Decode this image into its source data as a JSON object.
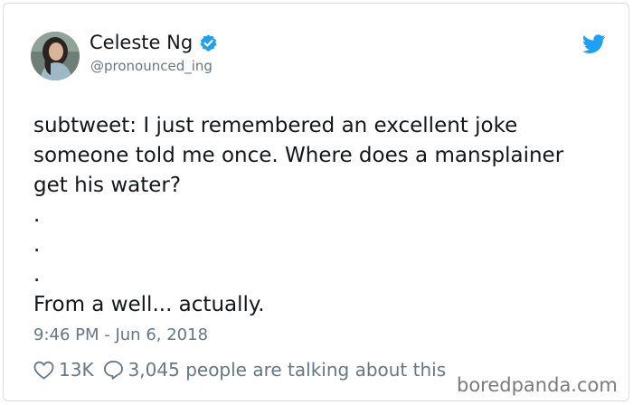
{
  "author": {
    "name": "Celeste Ng",
    "handle": "@pronounced_ing",
    "verified": true,
    "avatar_icon": "profile-photo"
  },
  "tweet": {
    "lines": [
      "subtweet: I just remembered an excellent joke",
      "someone told me once. Where does a mansplainer",
      "get his water?",
      ".",
      ".",
      ".",
      "From a well... actually."
    ],
    "timestamp": "9:46 PM - Jun 6, 2018"
  },
  "actions": {
    "likes": "13K",
    "replies_text": "3,045 people are talking about this"
  },
  "icons": {
    "verified": "verified-badge-icon",
    "brand": "twitter-bird-icon",
    "like": "heart-icon",
    "reply": "speech-bubble-icon"
  },
  "colors": {
    "brand": "#1da1f2",
    "text": "#14171a",
    "muted": "#657786"
  },
  "watermark": "boredpanda.com"
}
